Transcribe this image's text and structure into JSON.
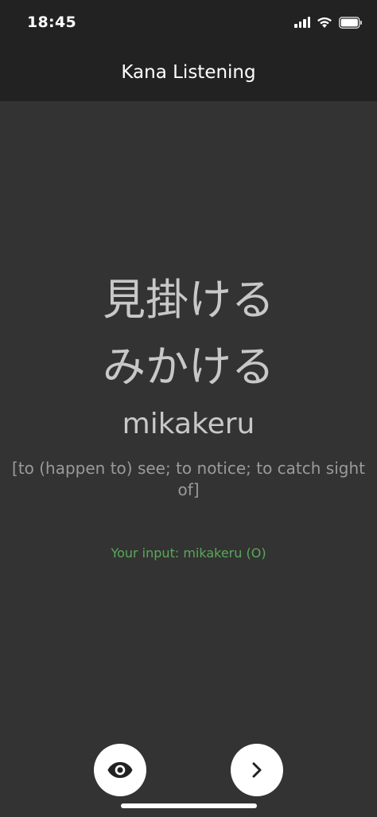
{
  "status_bar": {
    "time": "18:45",
    "icons": [
      "signal-icon",
      "wifi-icon",
      "battery-icon"
    ]
  },
  "nav": {
    "title": "Kana Listening"
  },
  "card": {
    "kanji": "見掛ける",
    "kana": "みかける",
    "romaji": "mikakeru",
    "meaning": "[to (happen to) see; to notice; to catch sight of]",
    "input_result": "Your input: mikakeru (O)"
  },
  "actions": {
    "reveal_icon": "eye-icon",
    "next_icon": "chevron-right-icon"
  },
  "colors": {
    "background": "#333333",
    "bar": "#222222",
    "text": "#c8c8c8",
    "meaning": "#9a9a9a",
    "correct": "#5aa85a"
  }
}
